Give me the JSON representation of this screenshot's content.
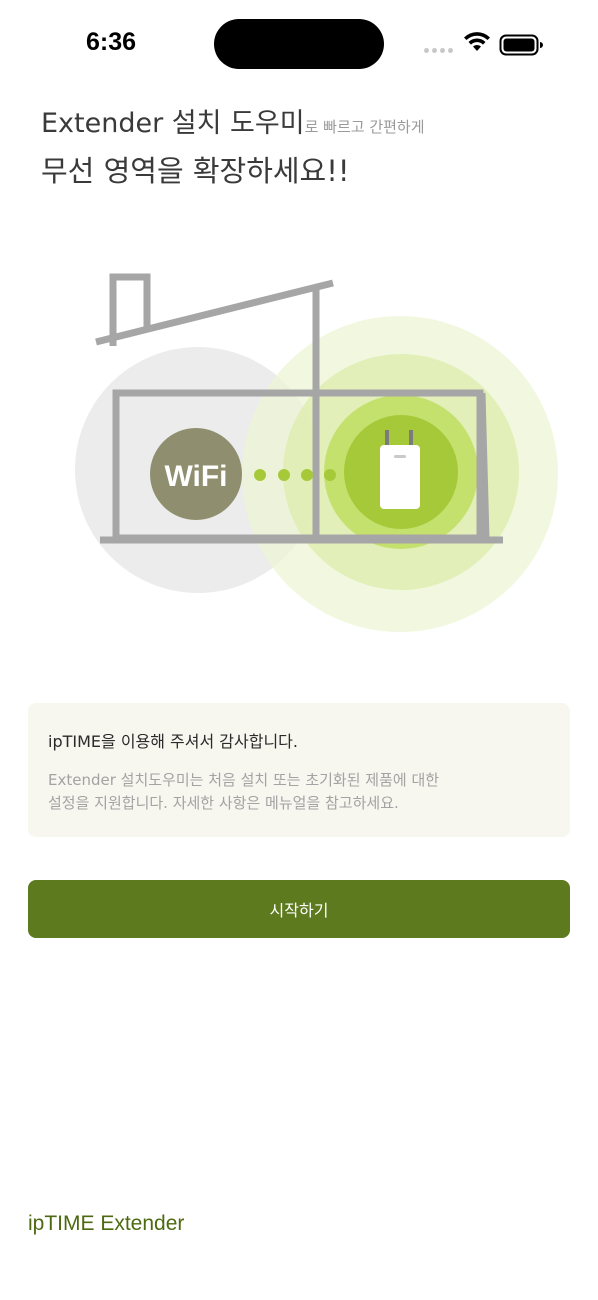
{
  "status_bar": {
    "time": "6:36"
  },
  "headline": {
    "line1_main": "Extender 설치 도우미",
    "line1_sub": "로 빠르고 간편하게",
    "line2": "무선 영역을 확장하세요!!"
  },
  "illustration": {
    "wifi_label": "WiFi"
  },
  "info_card": {
    "title": "ipTIME을 이용해 주셔서 감사합니다.",
    "description": "Extender 설치도우미는 처음 설치 또는 초기화된 제품에 대한\n설정을 지원합니다. 자세한 사항은 메뉴얼을 참고하세요."
  },
  "start_button": {
    "label": "시작하기"
  },
  "footer": {
    "brand": "ipTIME Extender"
  },
  "colors": {
    "primary": "#5d7a1e",
    "brand_text": "#4d6a12",
    "card_bg": "#f7f6ef",
    "wifi_circle": "#8f8f70",
    "extender_glow": "#a6c93a"
  },
  "icons": [
    "wifi-status-icon",
    "battery-icon",
    "house-outline-icon",
    "wifi-badge-icon",
    "extender-device-icon"
  ]
}
